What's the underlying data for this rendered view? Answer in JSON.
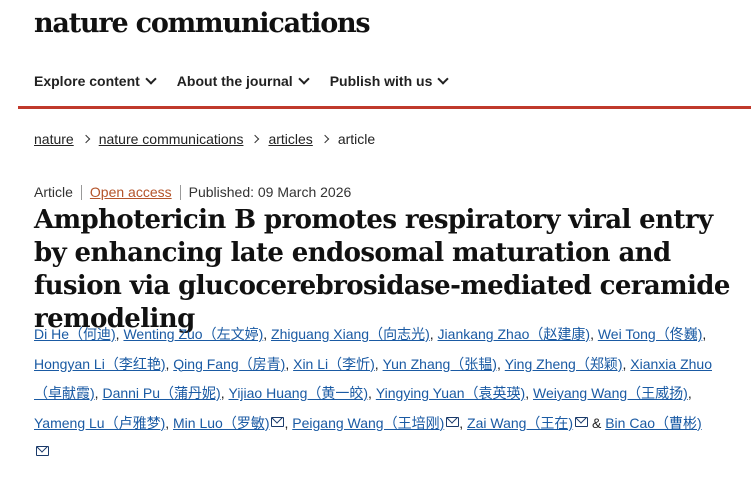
{
  "brand": "nature communications",
  "nav": [
    "Explore content",
    "About the journal",
    "Publish with us"
  ],
  "breadcrumb": [
    "nature",
    "nature communications",
    "articles",
    "article"
  ],
  "meta": {
    "type": "Article",
    "access": "Open access",
    "published": "Published: 09 March 2026"
  },
  "title": "Amphotericin B promotes respiratory viral entry by enhancing late endosomal maturation and fusion via glucocerebrosidase-mediated ceramide remodeling",
  "authors": [
    "Di He（何迪)",
    "Wenting Zuo（左文婷)",
    "Zhiguang Xiang（向志光)",
    "Jiankang Zhao（赵建康)",
    "Wei Tong（佟巍)",
    "Hongyan Li（李红艳)",
    "Qing Fang（房青)",
    "Xin Li（李忻)",
    "Yun Zhang（张韫)",
    "Ying Zheng（郑颖)",
    "Xianxia Zhuo（卓献霞)",
    "Danni Pu（蒲丹妮)",
    "Yijiao Huang（黄一皎)",
    "Yingying Yuan（袁英瑛)",
    "Weiyang Wang（王威扬)",
    "Yameng Lu（卢雅梦)",
    "Min Luo（罗敏)",
    "Peigang Wang（王培刚)",
    "Zai Wang（王在)",
    "Bin Cao（曹彬)"
  ],
  "last_author_conjunction": "&"
}
